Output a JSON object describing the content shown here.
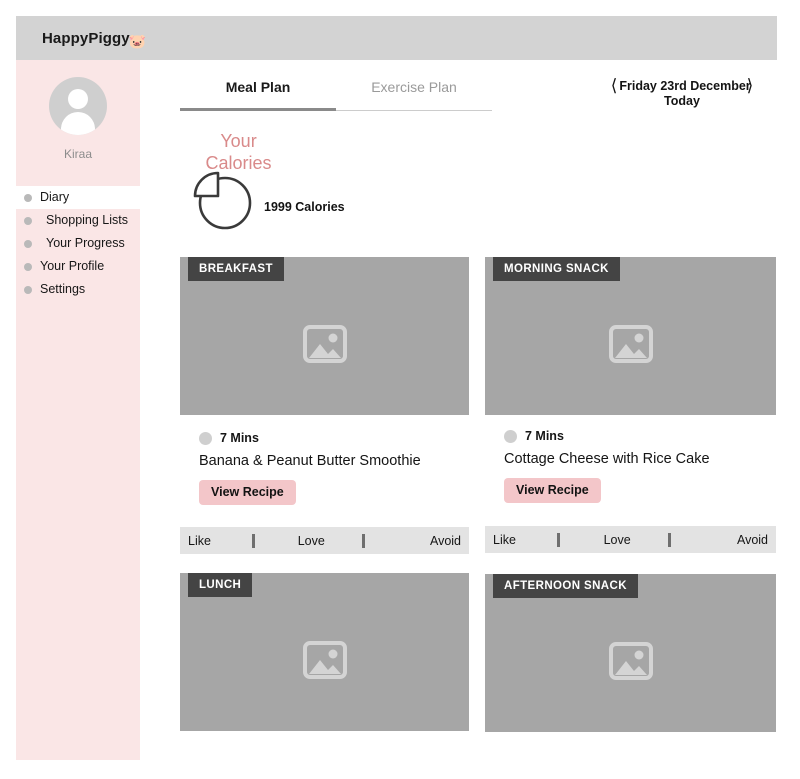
{
  "topbar": {
    "brand": "HappyPiggy",
    "pig_icon": "pig-face-icon"
  },
  "sidebar": {
    "profile": {
      "avatar_icon": "user-avatar-icon",
      "name": "Kiraa"
    },
    "items": [
      {
        "label": "Diary",
        "highlighted": true
      },
      {
        "label": "Shopping Lists",
        "highlighted": false
      },
      {
        "label": "Your Progress",
        "highlighted": false
      },
      {
        "label": "Your Profile",
        "highlighted": false
      },
      {
        "label": "Settings",
        "highlighted": false
      }
    ]
  },
  "tabs": [
    {
      "label": "Meal Plan",
      "active": true
    },
    {
      "label": "Exercise Plan",
      "active": false
    }
  ],
  "datenav": {
    "prev_icon": "chevron-left-icon",
    "next_icon": "chevron-right-icon",
    "date": "Friday 23rd December",
    "relative": "Today"
  },
  "calories": {
    "title": "Your Calories",
    "chart_icon": "pie-chart-icon",
    "value": "1999 Calories"
  },
  "rating": {
    "like": "Like",
    "love": "Love",
    "avoid": "Avoid"
  },
  "meals": {
    "breakfast": {
      "badge": "BREAKFAST",
      "placeholder_icon": "image-placeholder-icon",
      "time": "7 Mins",
      "title": "Banana & Peanut Butter Smoothie",
      "button": "View Recipe"
    },
    "morning_snack": {
      "badge": "MORNING SNACK",
      "placeholder_icon": "image-placeholder-icon",
      "time": "7 Mins",
      "title": "Cottage Cheese with Rice Cake",
      "button": "View Recipe"
    },
    "lunch": {
      "badge": "LUNCH",
      "placeholder_icon": "image-placeholder-icon"
    },
    "afternoon_snack": {
      "badge": "AFTERNOON SNACK",
      "placeholder_icon": "image-placeholder-icon"
    }
  },
  "colors": {
    "sidebar_pink": "#FAE6E6",
    "accent_pink": "#F3C6C9",
    "title_salmon": "#D98A8A",
    "topbar_gray": "#D3D3D3",
    "placeholder_gray": "#A6A6A6",
    "badge_gray": "#444444",
    "rating_gray": "#E3E3E3"
  }
}
